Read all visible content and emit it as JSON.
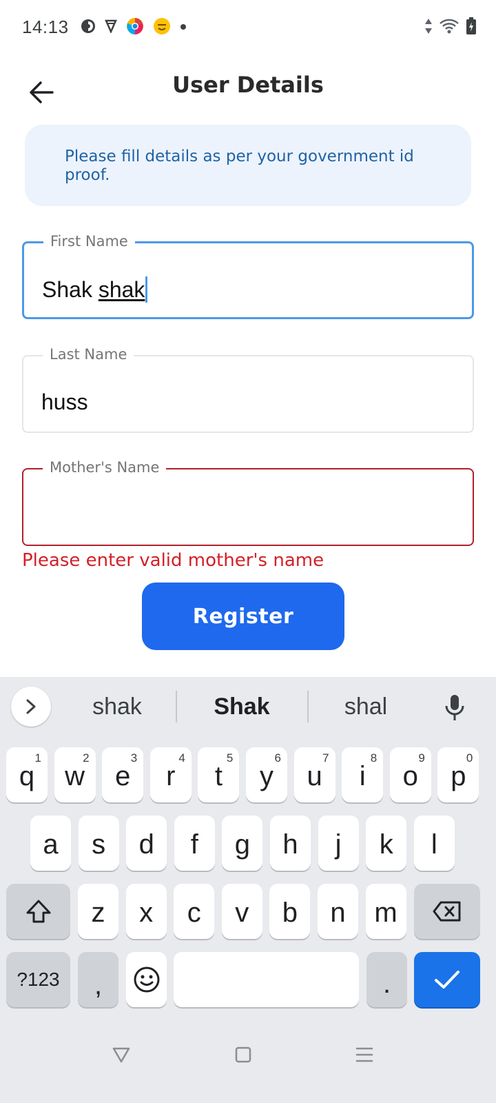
{
  "status_bar": {
    "time": "14:13",
    "left_icons": [
      "app-icon-1",
      "app-icon-2",
      "chrome-like-icon",
      "emoji-app-icon",
      "dot-icon"
    ],
    "right_icons": [
      "data-arrows-icon",
      "wifi-icon",
      "battery-charging-icon"
    ]
  },
  "app_bar": {
    "title": "User Details",
    "back_icon": "arrow-left-icon"
  },
  "info": {
    "text": "Please fill details as per your government id proof."
  },
  "form": {
    "first_name": {
      "label": "First Name",
      "value_prefix": "Shak ",
      "value_composing": "shak"
    },
    "last_name": {
      "label": "Last Name",
      "value": "huss"
    },
    "mothers_name": {
      "label": "Mother's Name",
      "value": "",
      "error": "Please enter valid mother's name"
    },
    "submit_label": "Register"
  },
  "keyboard": {
    "suggestions": [
      "shak",
      "Shak",
      "shal"
    ],
    "row1": [
      {
        "ch": "q",
        "sup": "1"
      },
      {
        "ch": "w",
        "sup": "2"
      },
      {
        "ch": "e",
        "sup": "3"
      },
      {
        "ch": "r",
        "sup": "4"
      },
      {
        "ch": "t",
        "sup": "5"
      },
      {
        "ch": "y",
        "sup": "6"
      },
      {
        "ch": "u",
        "sup": "7"
      },
      {
        "ch": "i",
        "sup": "8"
      },
      {
        "ch": "o",
        "sup": "9"
      },
      {
        "ch": "p",
        "sup": "0"
      }
    ],
    "row2": [
      "a",
      "s",
      "d",
      "f",
      "g",
      "h",
      "j",
      "k",
      "l"
    ],
    "row3": [
      "z",
      "x",
      "c",
      "v",
      "b",
      "n",
      "m"
    ],
    "symbols_label": "?123",
    "comma_label": ",",
    "period_label": "."
  },
  "colors": {
    "accent_blue": "#1f69ee",
    "focus_border": "#4a9ae9",
    "error_red": "#d32027",
    "info_bg": "#edf3fc",
    "info_text": "#1e63a6"
  }
}
